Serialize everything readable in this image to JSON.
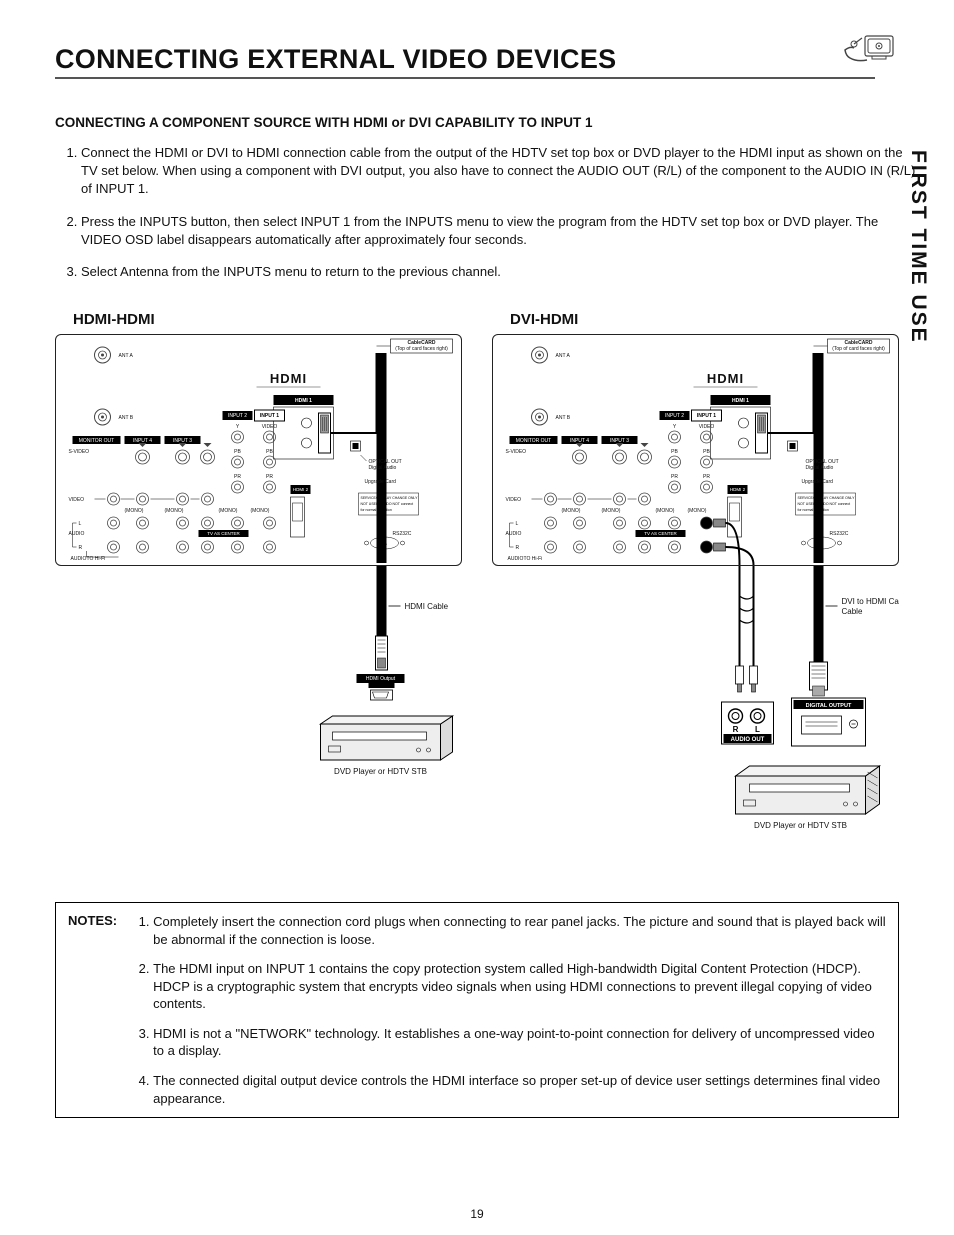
{
  "page": {
    "title": "CONNECTING EXTERNAL VIDEO DEVICES",
    "side_tab": "FIRST TIME USE",
    "page_number": "19"
  },
  "section": {
    "subhead": "CONNECTING A COMPONENT SOURCE WITH HDMI or DVI CAPABILITY TO INPUT 1",
    "steps": [
      "Connect the HDMI or DVI to HDMI connection cable from the output of the HDTV set top box or DVD player to the HDMI input as shown on the TV set below.  When using a component with DVI output, you also have to connect the AUDIO OUT (R/L) of the component to the AUDIO IN (R/L) of INPUT 1.",
      "Press the INPUTS button, then select INPUT 1 from the INPUTS menu to view the program from the HDTV set top box or DVD player.  The VIDEO OSD label disappears automatically after approximately four seconds.",
      "Select Antenna from the INPUTS menu to return to the previous channel."
    ]
  },
  "diagrams": {
    "left_title": "HDMI-HDMI",
    "right_title": "DVI-HDMI",
    "labels": {
      "cablecard": "CableCARD",
      "cablecard_hint": "(Top of card faces right)",
      "ant_a": "ANT A",
      "ant_b": "ANT B",
      "hdmi_brand": "HDMI",
      "hdmi1": "HDMI 1",
      "hdmi2": "HDMI 2",
      "input1": "INPUT 1",
      "input2": "INPUT 2",
      "input3": "INPUT 3",
      "input4": "INPUT 4",
      "monitor_out": "MONITOR OUT",
      "svideo": "S-VIDEO",
      "y": "Y",
      "pb": "PB",
      "pr": "PR",
      "video": "VIDEO",
      "mono": "(MONO)",
      "audio": "AUDIO",
      "r": "R",
      "l": "L",
      "tv_center": "TV AS CENTER",
      "to_hifi": "TO Hi-Fi",
      "optical": "OPTICAL OUT",
      "optical_sub": "Digital Audio",
      "upgrade": "Upgrade Card",
      "rs232": "RS232C",
      "service_box": "SERVICE/DISPLAY CHANGE ONLY\nNOT USED and DO NOT connect\nfor normal operation",
      "hdmi_cable": "HDMI Cable",
      "dvi_cable": "DVI to HDMI Cable",
      "hdmi_output": "HDMI Output",
      "dvd_player": "DVD Player or HDTV STB",
      "audio_out": "AUDIO OUT",
      "digital_output": "DIGITAL OUTPUT"
    }
  },
  "notes": {
    "label": "NOTES:",
    "items": [
      "Completely insert the connection cord plugs when connecting to rear panel jacks.  The picture and sound that is played back will be abnormal if the connection is loose.",
      "The HDMI input on INPUT 1 contains the copy protection system called High-bandwidth Digital Content Protection (HDCP).  HDCP is a cryptographic system that encrypts video signals when using HDMI connections to prevent illegal copying of video contents.",
      "HDMI is not a \"NETWORK\" technology.  It establishes a one-way point-to-point connection for delivery of uncompressed video to a display.",
      "The connected digital output device controls the HDMI interface so proper set-up of device user settings determines final video appearance."
    ]
  }
}
